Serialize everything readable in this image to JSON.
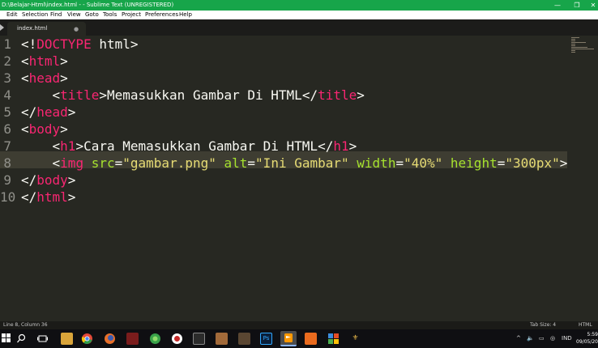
{
  "window": {
    "title": "D:\\Belajar-Html\\index.html - - Sublime Text (UNREGISTERED)",
    "minimize": "—",
    "maximize": "❐",
    "close": "✕"
  },
  "menu": [
    "Edit",
    "Selection",
    "Find",
    "View",
    "Goto",
    "Tools",
    "Project",
    "Preferences",
    "Help"
  ],
  "tab": {
    "label": "index.html",
    "close_glyph": "●"
  },
  "editor": {
    "active_line": 8,
    "lines": [
      {
        "n": "1",
        "tokens": [
          [
            "pun",
            "<!"
          ],
          [
            "tag",
            "DOCTYPE"
          ],
          [
            "txt",
            " html"
          ],
          [
            "pun",
            ">"
          ]
        ]
      },
      {
        "n": "2",
        "tokens": [
          [
            "pun",
            "<"
          ],
          [
            "tag",
            "html"
          ],
          [
            "pun",
            ">"
          ]
        ]
      },
      {
        "n": "3",
        "tokens": [
          [
            "pun",
            "<"
          ],
          [
            "tag",
            "head"
          ],
          [
            "pun",
            ">"
          ]
        ]
      },
      {
        "n": "4",
        "tokens": [
          [
            "txt",
            "    "
          ],
          [
            "pun",
            "<"
          ],
          [
            "tag",
            "title"
          ],
          [
            "pun",
            ">"
          ],
          [
            "txt",
            "Memasukkan Gambar Di HTML"
          ],
          [
            "pun",
            "</"
          ],
          [
            "tag",
            "title"
          ],
          [
            "pun",
            ">"
          ]
        ]
      },
      {
        "n": "5",
        "tokens": [
          [
            "pun",
            "</"
          ],
          [
            "tag",
            "head"
          ],
          [
            "pun",
            ">"
          ]
        ]
      },
      {
        "n": "6",
        "tokens": [
          [
            "pun",
            "<"
          ],
          [
            "tag",
            "body"
          ],
          [
            "pun",
            ">"
          ]
        ]
      },
      {
        "n": "7",
        "tokens": [
          [
            "txt",
            "    "
          ],
          [
            "pun",
            "<"
          ],
          [
            "tag",
            "h1"
          ],
          [
            "pun",
            ">"
          ],
          [
            "txt",
            "Cara Memasukkan Gambar Di HTML"
          ],
          [
            "pun",
            "</"
          ],
          [
            "tag",
            "h1"
          ],
          [
            "pun",
            ">"
          ]
        ]
      },
      {
        "n": "8",
        "tokens": [
          [
            "txt",
            "    "
          ],
          [
            "pun",
            "<"
          ],
          [
            "tag",
            "img"
          ],
          [
            "txt",
            " "
          ],
          [
            "attr",
            "src"
          ],
          [
            "pun",
            "="
          ],
          [
            "str",
            "\"gambar.png\""
          ],
          [
            "txt",
            " "
          ],
          [
            "attr",
            "alt"
          ],
          [
            "pun",
            "="
          ],
          [
            "str",
            "\"Ini Gambar\""
          ],
          [
            "txt",
            " "
          ],
          [
            "attr",
            "width"
          ],
          [
            "pun",
            "="
          ],
          [
            "str",
            "\"40%\""
          ],
          [
            "txt",
            " "
          ],
          [
            "attr",
            "height"
          ],
          [
            "pun",
            "="
          ],
          [
            "str",
            "\"300px\""
          ],
          [
            "pun",
            ">"
          ]
        ]
      },
      {
        "n": "9",
        "tokens": [
          [
            "pun",
            "</"
          ],
          [
            "tag",
            "body"
          ],
          [
            "pun",
            ">"
          ]
        ]
      },
      {
        "n": "10",
        "tokens": [
          [
            "pun",
            "</"
          ],
          [
            "tag",
            "html"
          ],
          [
            "pun",
            ">"
          ]
        ]
      }
    ]
  },
  "status": {
    "position": "Line 8, Column 36",
    "tab_size": "Tab Size: 4",
    "syntax": "HTML"
  },
  "taskbar": {
    "tray_chevron": "^",
    "language": "IND",
    "time": "5:59",
    "date": "09/05/20"
  },
  "colors": {
    "titlebar": "#17a54a",
    "editor_bg": "#272822",
    "tag": "#f92672",
    "attr": "#a6e22e",
    "string": "#e6db74"
  }
}
